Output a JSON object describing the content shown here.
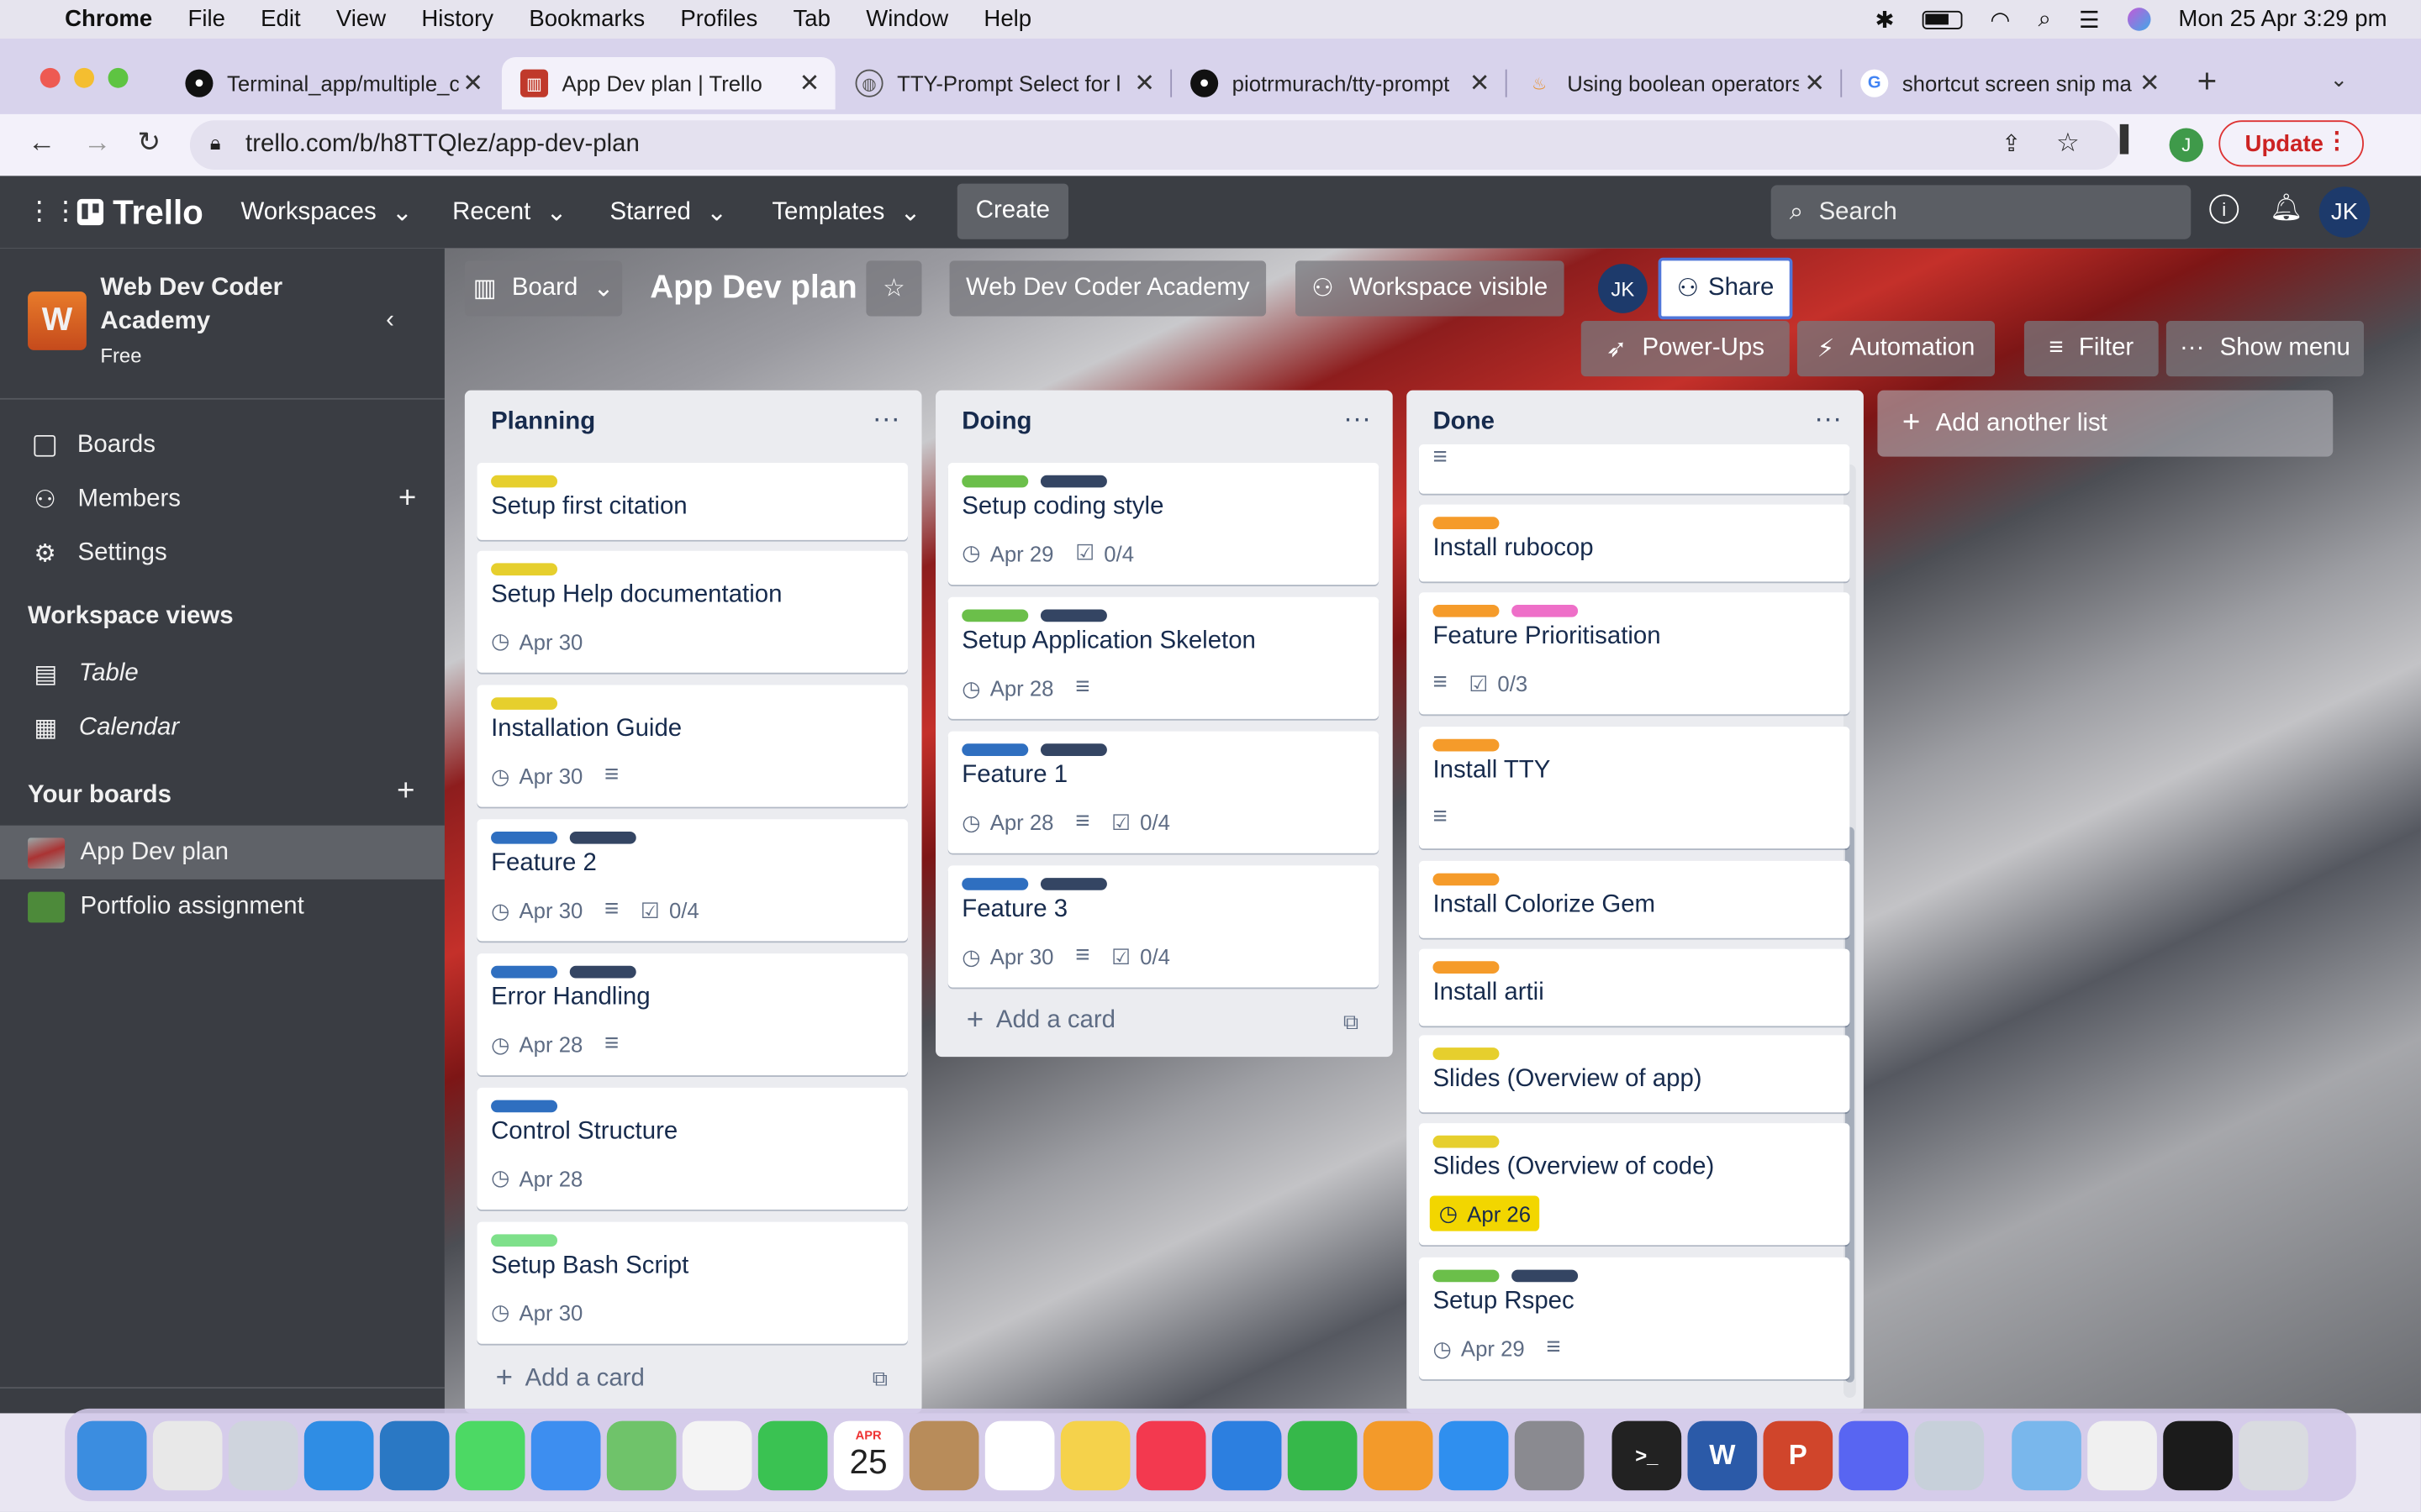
{
  "menubar": {
    "apple": "",
    "app": "Chrome",
    "items": [
      "File",
      "Edit",
      "View",
      "History",
      "Bookmarks",
      "Profiles",
      "Tab",
      "Window",
      "Help"
    ],
    "datetime": "Mon 25 Apr  3:29 pm"
  },
  "tabs": [
    {
      "title": "Terminal_app/multiple_c",
      "icon": "github-icon"
    },
    {
      "title": "App Dev plan | Trello",
      "icon": "trello-icon"
    },
    {
      "title": "TTY-Prompt Select for l",
      "icon": "globe-icon"
    },
    {
      "title": "piotrmurach/tty-prompt",
      "icon": "github-icon"
    },
    {
      "title": "Using boolean operators",
      "icon": "flame-icon"
    },
    {
      "title": "shortcut screen snip ma",
      "icon": "google-icon"
    }
  ],
  "address": {
    "url": "trello.com/b/h8TTQlez/app-dev-plan",
    "profile": "J",
    "update_label": "Update"
  },
  "trello_header": {
    "logo": "Trello",
    "nav": [
      "Workspaces",
      "Recent",
      "Starred",
      "Templates"
    ],
    "create": "Create",
    "search_placeholder": "Search",
    "avatar": "JK"
  },
  "sidebar": {
    "workspace_initial": "W",
    "workspace_name_line1": "Web Dev Coder",
    "workspace_name_line2": "Academy",
    "plan": "Free",
    "items": [
      {
        "label": "Boards",
        "icon": "board-icon"
      },
      {
        "label": "Members",
        "icon": "person-icon"
      },
      {
        "label": "Settings",
        "icon": "gear-icon"
      }
    ],
    "views_heading": "Workspace views",
    "views": [
      {
        "label": "Table",
        "icon": "table-icon"
      },
      {
        "label": "Calendar",
        "icon": "calendar-icon"
      }
    ],
    "boards_heading": "Your boards",
    "boards": [
      {
        "label": "App Dev plan",
        "color": "#9b2b2b"
      },
      {
        "label": "Portfolio assignment",
        "color": "#4d8a3a"
      }
    ]
  },
  "board": {
    "view": "Board",
    "title": "App Dev plan",
    "workspace": "Web Dev Coder Academy",
    "visibility": "Workspace visible",
    "member": "JK",
    "share": "Share",
    "powerups": "Power-Ups",
    "automation": "Automation",
    "filter": "Filter",
    "show_menu": "Show menu",
    "add_list": "Add another list",
    "add_card": "Add a card"
  },
  "colors": {
    "yellow": "#e6cf2d",
    "green": "#6bbf4a",
    "lightgreen": "#7ee08a",
    "navy": "#344563",
    "blue": "#2f6fc0",
    "orange": "#f59b2a",
    "pink": "#ee6fc8",
    "due_soon": "#f2d600"
  },
  "lists": [
    {
      "title": "Planning",
      "cards": [
        {
          "title": "Setup first citation",
          "labels": [
            "yellow"
          ],
          "date": "",
          "desc": false,
          "checklist": ""
        },
        {
          "title": "Setup Help documentation",
          "labels": [
            "yellow"
          ],
          "date": "Apr 30",
          "desc": false,
          "checklist": ""
        },
        {
          "title": "Installation Guide",
          "labels": [
            "yellow"
          ],
          "date": "Apr 30",
          "desc": true,
          "checklist": ""
        },
        {
          "title": "Feature 2",
          "labels": [
            "blue",
            "navy"
          ],
          "date": "Apr 30",
          "desc": true,
          "checklist": "0/4"
        },
        {
          "title": "Error Handling",
          "labels": [
            "blue",
            "navy"
          ],
          "date": "Apr 28",
          "desc": true,
          "checklist": ""
        },
        {
          "title": "Control Structure",
          "labels": [
            "blue"
          ],
          "date": "Apr 28",
          "desc": false,
          "checklist": ""
        },
        {
          "title": "Setup Bash Script",
          "labels": [
            "lightgreen"
          ],
          "date": "Apr 30",
          "desc": false,
          "checklist": ""
        }
      ]
    },
    {
      "title": "Doing",
      "cards": [
        {
          "title": "Setup coding style",
          "labels": [
            "green",
            "navy"
          ],
          "date": "Apr 29",
          "desc": false,
          "checklist": "0/4"
        },
        {
          "title": "Setup Application Skeleton",
          "labels": [
            "green",
            "navy"
          ],
          "date": "Apr 28",
          "desc": true,
          "checklist": ""
        },
        {
          "title": "Feature 1",
          "labels": [
            "blue",
            "navy"
          ],
          "date": "Apr 28",
          "desc": true,
          "checklist": "0/4"
        },
        {
          "title": "Feature 3",
          "labels": [
            "blue",
            "navy"
          ],
          "date": "Apr 30",
          "desc": true,
          "checklist": "0/4"
        }
      ]
    },
    {
      "title": "Done",
      "cards": [
        {
          "title": "",
          "labels": [],
          "date": "",
          "desc": true,
          "checklist": ""
        },
        {
          "title": "Install rubocop",
          "labels": [
            "orange"
          ],
          "date": "",
          "desc": false,
          "checklist": ""
        },
        {
          "title": "Feature Prioritisation",
          "labels": [
            "orange",
            "pink"
          ],
          "date": "",
          "desc": true,
          "checklist": "0/3"
        },
        {
          "title": "Install TTY",
          "labels": [
            "orange"
          ],
          "date": "",
          "desc": true,
          "checklist": ""
        },
        {
          "title": "Install Colorize Gem",
          "labels": [
            "orange"
          ],
          "date": "",
          "desc": false,
          "checklist": ""
        },
        {
          "title": "Install artii",
          "labels": [
            "orange"
          ],
          "date": "",
          "desc": false,
          "checklist": ""
        },
        {
          "title": "Slides (Overview of app)",
          "labels": [
            "yellow"
          ],
          "date": "",
          "desc": false,
          "checklist": ""
        },
        {
          "title": "Slides (Overview of code)",
          "labels": [
            "yellow"
          ],
          "date": "Apr 26",
          "due_soon": true,
          "desc": false,
          "checklist": ""
        },
        {
          "title": "Setup Rspec",
          "labels": [
            "green",
            "navy"
          ],
          "date": "Apr 29",
          "desc": true,
          "checklist": ""
        }
      ]
    }
  ],
  "dock": {
    "calendar_month": "APR",
    "calendar_day": "25",
    "apps": [
      "finder-icon",
      "chrome-icon",
      "launchpad-icon",
      "safari-icon",
      "vscode-icon",
      "messages-icon",
      "mail-icon",
      "maps-icon",
      "photos-icon",
      "facetime-icon",
      "calendar-icon",
      "contacts-icon",
      "reminders-icon",
      "notes-icon",
      "music-icon",
      "keynote-icon",
      "numbers-icon",
      "pages-icon",
      "appstore-icon",
      "system-preferences-icon",
      "terminal-icon",
      "word-icon",
      "powerpoint-icon",
      "discord-icon",
      "preview-icon",
      "folder-icon",
      "document-icon",
      "screen-icon",
      "trash-icon"
    ]
  }
}
